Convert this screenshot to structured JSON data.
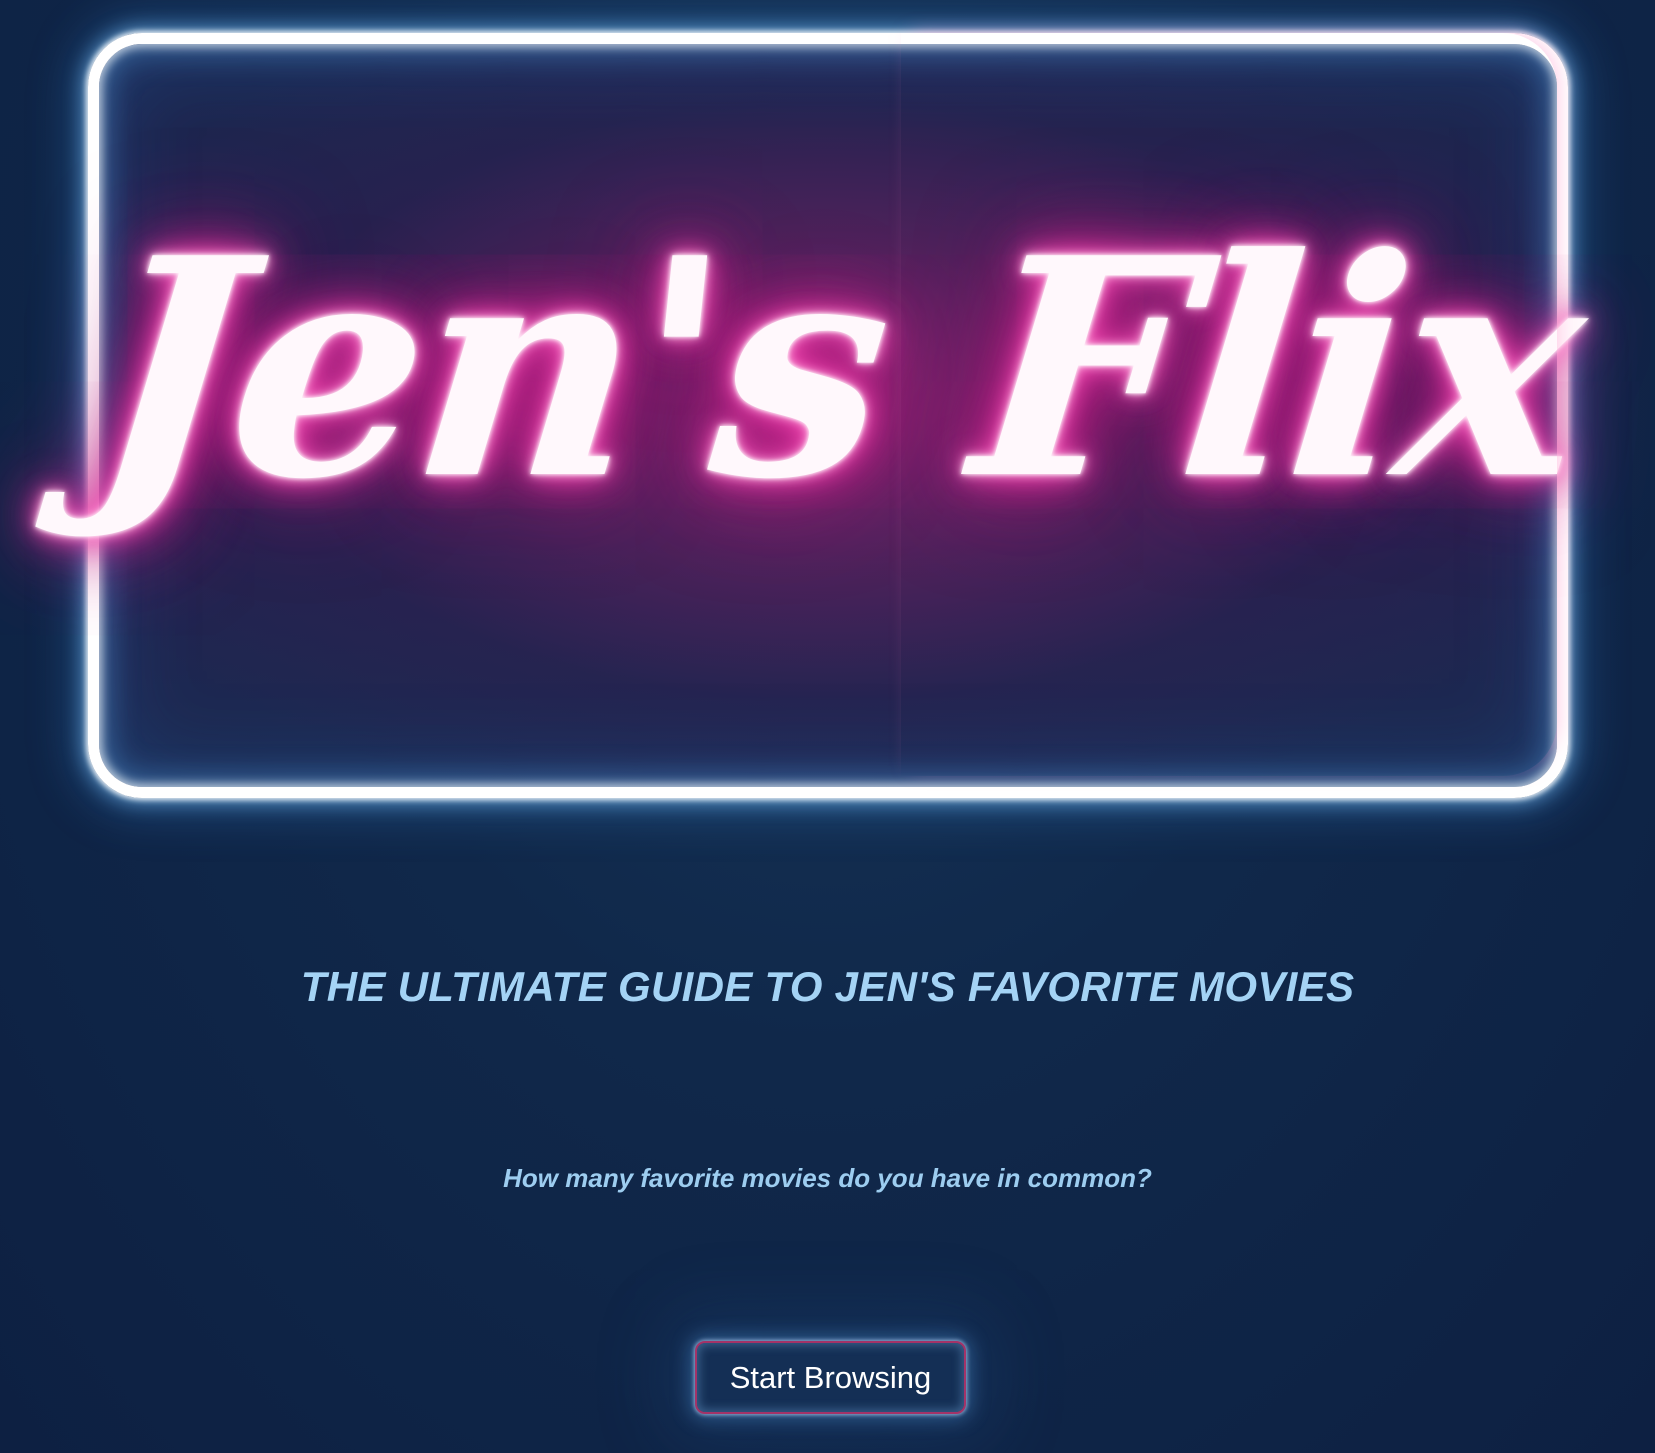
{
  "hero": {
    "title": "Jen's Flix"
  },
  "tagline": "THE ULTIMATE GUIDE TO JEN'S FAVORITE MOVIES",
  "question": "How many favorite movies do you have in common?",
  "cta": {
    "label": "Start Browsing"
  },
  "colors": {
    "background": "#0d2042",
    "neon_pink": "#e83aa6",
    "neon_frame": "#ffffff",
    "text_light_blue": "#a4d3f5",
    "button_border": "#a33368"
  }
}
